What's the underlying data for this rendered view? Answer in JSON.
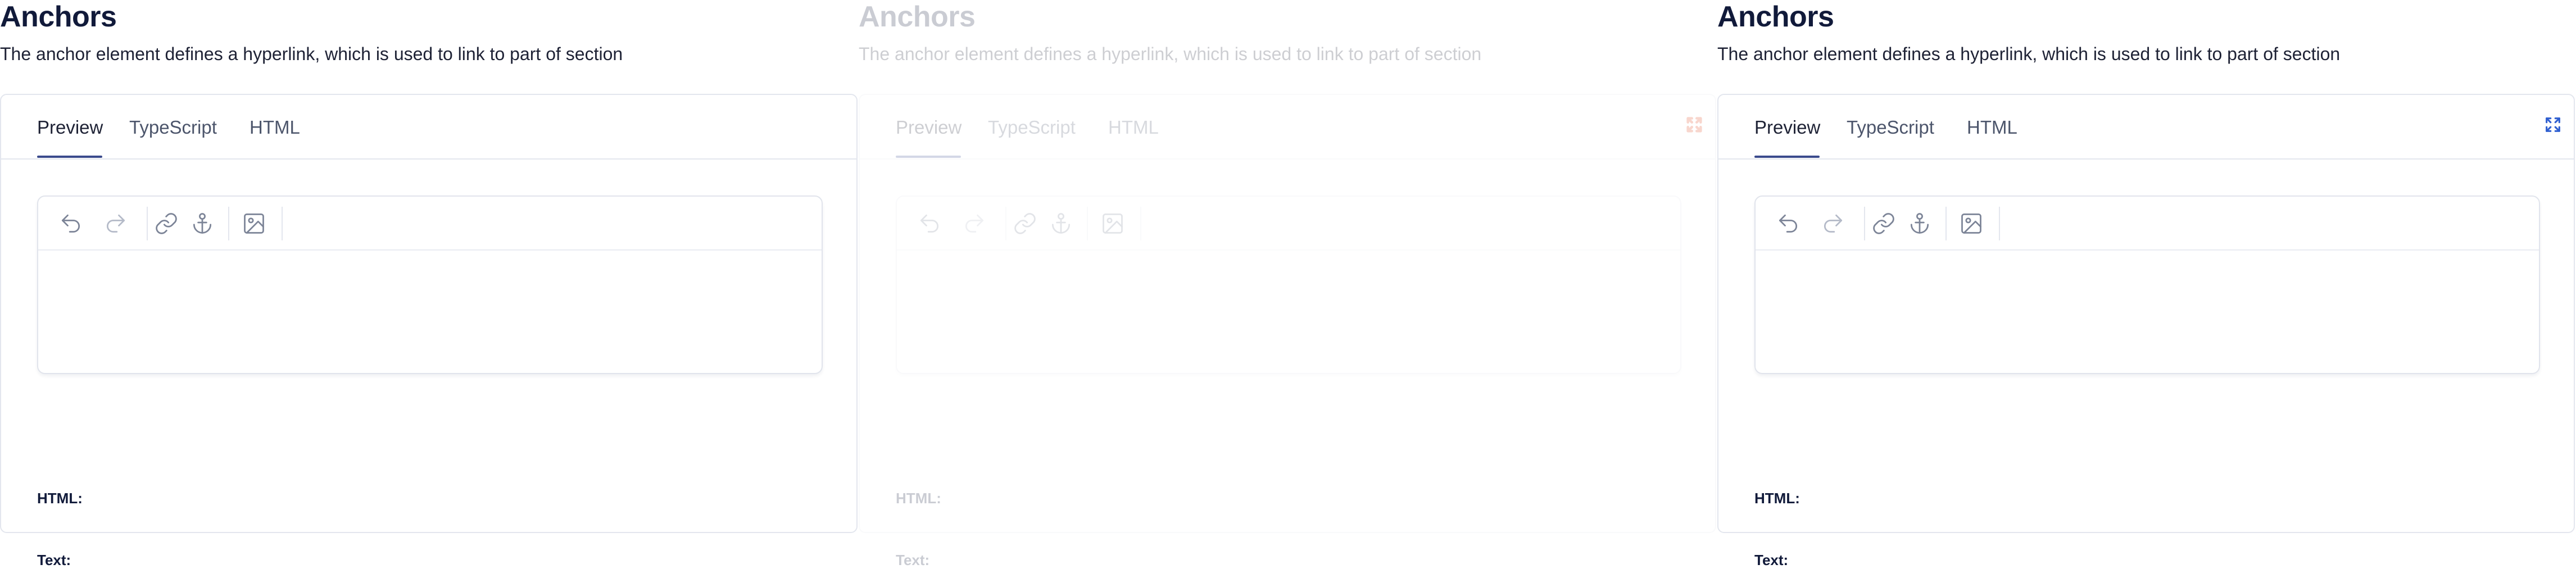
{
  "panels": [
    {
      "title": "Anchors",
      "subtitle": "The anchor element defines a hyperlink, which is used to link to part of section",
      "tabs": [
        "Preview",
        "TypeScript",
        "HTML"
      ],
      "active_tab": "Preview",
      "expand_icon": false,
      "output_labels": {
        "html": "HTML:",
        "text": "Text:"
      }
    },
    {
      "title": "Anchors",
      "subtitle": "The anchor element defines a hyperlink, which is used to link to part of section",
      "tabs": [
        "Preview",
        "TypeScript",
        "HTML"
      ],
      "active_tab": "Preview",
      "expand_icon": true,
      "output_labels": {
        "html": "HTML:",
        "text": "Text:"
      }
    },
    {
      "title": "Anchors",
      "subtitle": "The anchor element defines a hyperlink, which is used to link to part of section",
      "tabs": [
        "Preview",
        "TypeScript",
        "HTML"
      ],
      "active_tab": "Preview",
      "expand_icon": true,
      "output_labels": {
        "html": "HTML:",
        "text": "Text:"
      }
    }
  ],
  "toolbar_icons": [
    "undo-icon",
    "redo-icon",
    "link-icon",
    "anchor-icon",
    "image-icon"
  ],
  "colors": {
    "accent": "#3a4a8c",
    "expand_icon_panel2": "#e0441e",
    "expand_icon_panel3": "#2f5fd0",
    "border": "#e3e6ee",
    "text": "#1e2235"
  }
}
